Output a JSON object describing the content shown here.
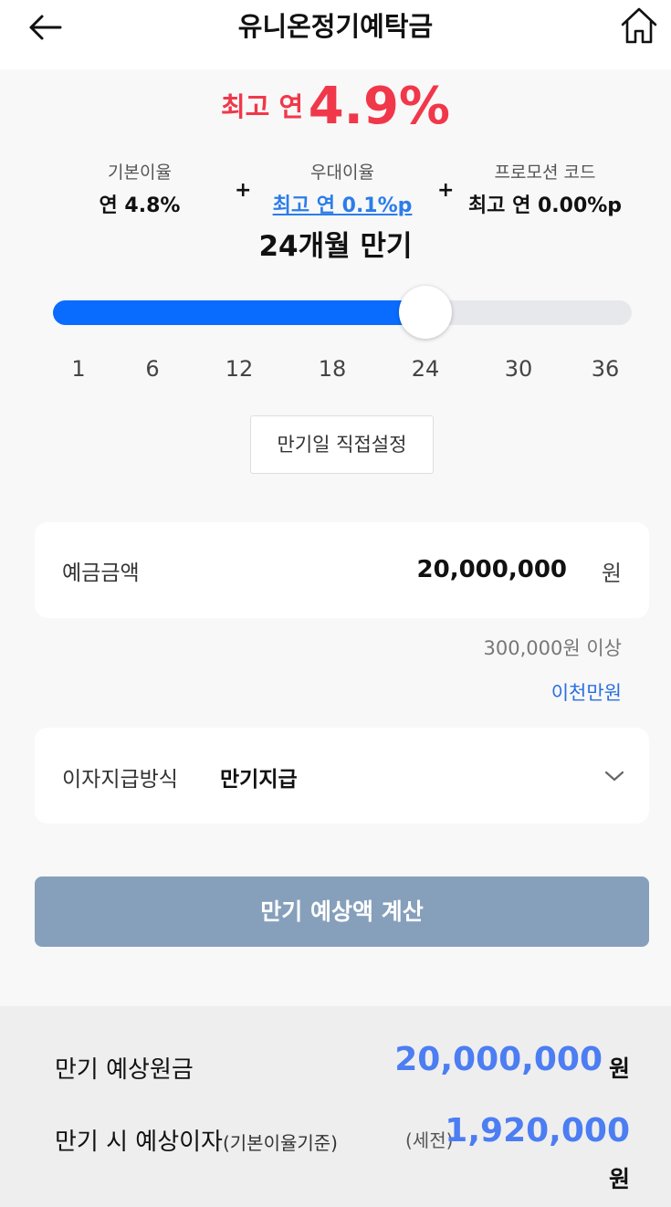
{
  "header": {
    "title": "유니온정기예탁금",
    "back_icon": "arrow-left-icon",
    "home_icon": "home-icon"
  },
  "headline": {
    "prefix": "최고 연",
    "rate": "4.9%"
  },
  "rates": {
    "base_label": "기본이율",
    "base_value": "연 4.8%",
    "pref_label": "우대이율",
    "pref_value": "최고 연 0.1%p",
    "promo_label": "프로모션 코드",
    "promo_value": "최고 연 0.00%p",
    "plus": "+"
  },
  "term": {
    "label": "24개월 만기",
    "value_months": 24,
    "min": 1,
    "max": 36,
    "ticks": [
      "1",
      "6",
      "12",
      "18",
      "24",
      "30",
      "36"
    ]
  },
  "custom_date_button": "만기일 직접설정",
  "amount": {
    "label": "예금금액",
    "value": "20,000,000",
    "unit": "원",
    "min_note": "300,000원 이상",
    "korean": "이천만원"
  },
  "method": {
    "label": "이자지급방식",
    "value": "만기지급",
    "icon": "chevron-down-icon"
  },
  "calc_button": "만기 예상액 계산",
  "result": {
    "principal_label": "만기 예상원금",
    "principal_value": "20,000,000",
    "principal_unit": "원",
    "interest_label": "만기 시 예상이자",
    "interest_sub": "(기본이율기준)",
    "tax_note": "(세전)",
    "interest_value": "1,920,000",
    "interest_unit": "원"
  },
  "colors": {
    "accent_red": "#f0384a",
    "slider_blue": "#0a6cff",
    "link_blue": "#2b7de9",
    "result_blue": "#4c7df2",
    "button_gray_blue": "#86a0bb"
  }
}
